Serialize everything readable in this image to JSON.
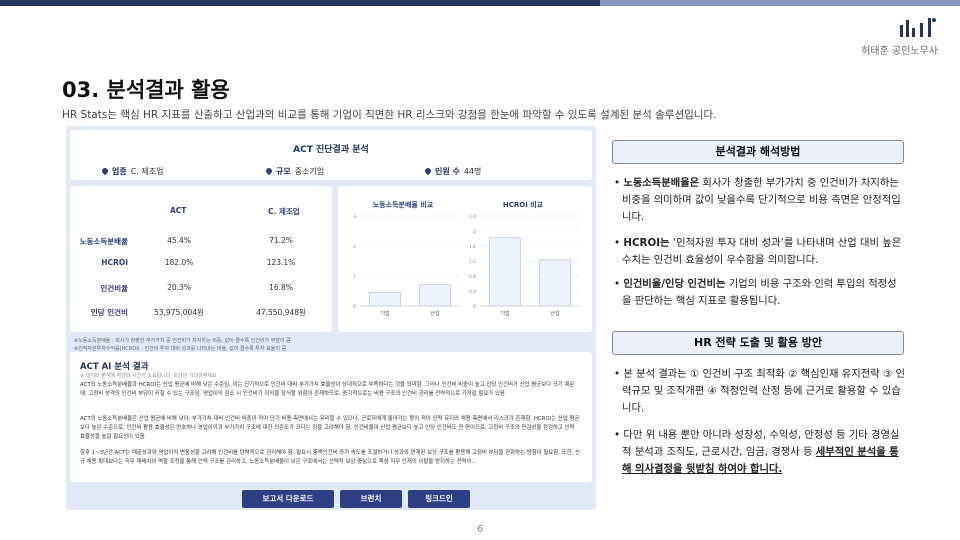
{
  "brand": {
    "firm_name": "허태훈 공인노무사",
    "accent": "#26345a",
    "accent_light": "#8a96b8"
  },
  "slide": {
    "title": "03. 분석결과 활용",
    "subtitle": "HR Stats는 핵심 HR 지표를 산출하고 산업과의 비교를 통해 기업이 직면한 HR 리스크와 강점을 한눈에 파악할 수 있도록 설계된 분석 솔루션입니다.",
    "page_number": "6"
  },
  "diagnosis": {
    "title": "ACT 진단결과 분석",
    "info": [
      {
        "key": "업종",
        "value": "C. 제조업"
      },
      {
        "key": "규모",
        "value": "중소기업"
      },
      {
        "key": "인원 수",
        "value": "44명"
      }
    ]
  },
  "table": {
    "headers": [
      "ACT",
      "C. 제조업"
    ],
    "rows": [
      {
        "label": "노동소득분배율",
        "act": "45.4%",
        "industry": "71.2%"
      },
      {
        "label": "HCROI",
        "act": "182.0%",
        "industry": "123.1%"
      },
      {
        "label": "인건비율",
        "act": "20.3%",
        "industry": "16.8%"
      },
      {
        "label": "인당 인건비",
        "act": "53,975,004원",
        "industry": "47,550,948원"
      }
    ]
  },
  "chart_data": [
    {
      "type": "bar",
      "title": "노동소득분배율 비교",
      "categories": [
        "기업",
        "산업"
      ],
      "values": [
        0.454,
        0.712
      ],
      "yticks": [
        "0",
        "1",
        "2",
        "3"
      ],
      "ylim": [
        0,
        3
      ]
    },
    {
      "type": "bar",
      "title": "HCROI 비교",
      "categories": [
        "기업",
        "산업"
      ],
      "values": [
        1.82,
        1.231
      ],
      "yticks": [
        "0",
        "0.4",
        "0.8",
        "1.2",
        "1.6",
        "2",
        "2.4"
      ],
      "ylim": [
        0,
        2.4
      ]
    }
  ],
  "footnotes": [
    "※노동소득분배율 : 회사가 창출한 부가가치 중 인건비가 차지하는 비중, 값이 클수록 인건비가 부담이 큼",
    "※인적자원투자수익률(HCROI) : 인건비 투자 대비 성과를 나타내는 비율, 값이 클수록 투자 효율이 큼"
  ],
  "ai_analysis": {
    "title": "ACT AI 분석 결과",
    "note": "※ 데이터 분석에 약간의 시간이 소요됩니다. 조금만 기다려주세요",
    "paragraphs": [
      "ACT의 노동소득분배율과 HCROI는 산업 평균에 비해 낮은 수준임. 이는 단기적으로 인건비 대비 부가가치 효율성이 상대적으로 부족하다는 것을 의미함. 그러나 인건비 비중이 높고 인당 인건비가 산업 평균보다 크기 때문에, 고정비 성격의 인건비 부담이 커질 수 있는 구조임. 영업이익 감소 시 인건비가 이익을 잠식할 위험이 존재하므로, 중기적으로는 비용 구조의 인건비 관리를 전략적으로 가져갈 필요가 있음.",
      "ACT의 노동소득분배율은 산업 평균에 비해 낮아, 부가가치 대비 인건비 비중이 적어 단기 비용 측면에서는 유리할 수 있으나, 근로자에게 돌아가는 몫이 적어 인력 유지와 채용 측면에서 리스크가 존재함. HCROI는 산업 평균보다 높은 수준으로, 인건비 활용 효율성은 양호하나 영업이익과 부가가치 구조에 대한 의존도가 크다는 점을 고려해야 함. 인건비율이 산업 평균보다 높고 인당 인건비도 큰 편이므로, 고정비 구조의 민감성을 점검하고 인력 효율성을 높일 필요성이 있음.",
      "향후 1~3년간 ACT는 매출성과와 영업이익 변동성을 고려해 인건비를 탄력적으로 관리해야 함. 필요시 총액인건비 증가 속도를 조절하거나 성과와 연계된 보상 구조를 활용해 고정비 부담을 완화하는 방향이 필요함. 또한, 신규 채용 확대보다는 직무 재배치와 역할 조정을 통해 인력 구조를 관리하고, 노동소득분배율이 낮은 구조에서는 선택적 보상 중심으로 핵심 직무 인재의 이탈을 방지하는 전략이..."
    ]
  },
  "buttons": [
    "보고서 다운로드",
    "브런치",
    "링크드인"
  ],
  "methods": {
    "heading": "분석결과 해석방법",
    "items": [
      {
        "term": "노동소득분배율은",
        "text": " 회사가 창출한 부가가치 중 인건비가 차지하는 비중을 의미하며 값이 낮을수록 단기적으로 비용 측면은 안정적입니다."
      },
      {
        "term": "HCROI는",
        "text": " ‘인적자원 투자 대비 성과’를 나타내며 산업 대비 높은 수치는 인건비 효율성이 우수함을 의미합니다."
      },
      {
        "term": "인건비율/인당 인건비는",
        "text": " 기업의 비용 구조와 인력 투입의 적정성을 판단하는 핵심 지표로 활용됩니다."
      }
    ]
  },
  "strategy": {
    "heading": "HR 전략 도출 및 활용 방안",
    "item1": "본 분석 결과는 ① 인건비 구조 최적화 ② 핵심인재 유지전략 ③ 인력규모 및 조직개편 ④ 적정인력 산정 등에 근거로 활용할 수 있습니다.",
    "item2_text": "다만 위 내용 뿐만 아니라 성장성, 수익성, 안정성 등 기타 경영실적 분석과 조직도, 근로시간, 임금, 경쟁사 등 ",
    "item2_emph": "세부적인 분석을 통해 의사결정을 뒷받침 하여야 합니다."
  }
}
